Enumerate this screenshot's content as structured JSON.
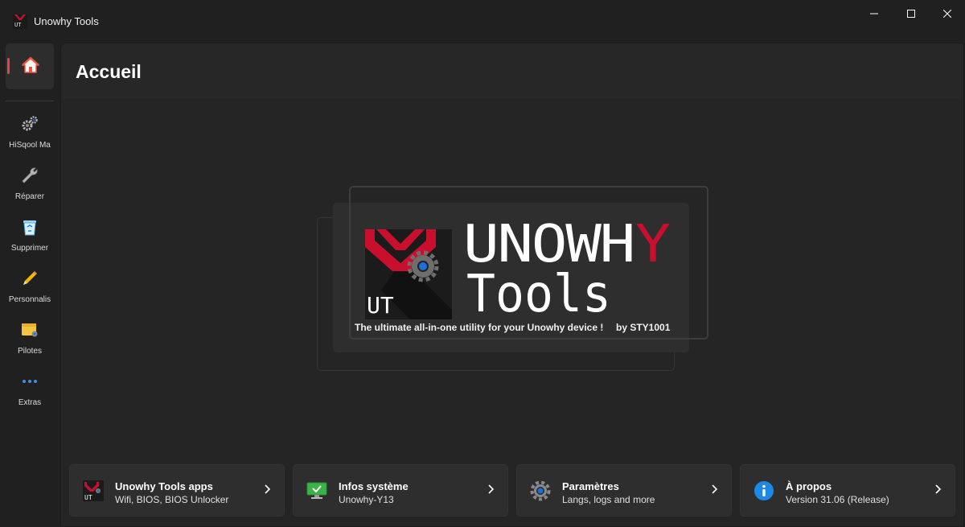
{
  "window": {
    "title": "Unowhy Tools",
    "logo_text": "UT"
  },
  "sidebar": {
    "home_icon": "home-icon",
    "items": [
      {
        "label": "HiSqool Ma",
        "icon": "gears-icon"
      },
      {
        "label": "Réparer",
        "icon": "wrench-icon"
      },
      {
        "label": "Supprimer",
        "icon": "recycle-bin-icon"
      },
      {
        "label": "Personnalis",
        "icon": "pencil-icon"
      },
      {
        "label": "Pilotes",
        "icon": "driver-folder-icon"
      },
      {
        "label": "Extras",
        "icon": "more-dots-icon"
      }
    ]
  },
  "main": {
    "title": "Accueil",
    "hero": {
      "brand_line1": "UNOWH",
      "brand_line1_accent": "Y",
      "brand_line2": "Tools",
      "mark_text": "UT",
      "tagline": "The ultimate all-in-one utility for your Unowhy device !",
      "byline": "by STY1001"
    },
    "cards": [
      {
        "title": "Unowhy Tools apps",
        "subtitle": "Wifi, BIOS, BIOS Unlocker",
        "icon": "unowhy-tools-logo-icon"
      },
      {
        "title": "Infos système",
        "subtitle": "Unowhy-Y13",
        "icon": "monitor-check-icon"
      },
      {
        "title": "Paramètres",
        "subtitle": "Langs, logs and more",
        "icon": "settings-gear-icon"
      },
      {
        "title": "À propos",
        "subtitle": "Version 31.06 (Release)",
        "icon": "info-icon"
      }
    ]
  },
  "colors": {
    "accent_red": "#c8102e",
    "nav_indicator": "#e0454a",
    "info_blue": "#1e88e5",
    "monitor_green": "#3cb34a"
  }
}
